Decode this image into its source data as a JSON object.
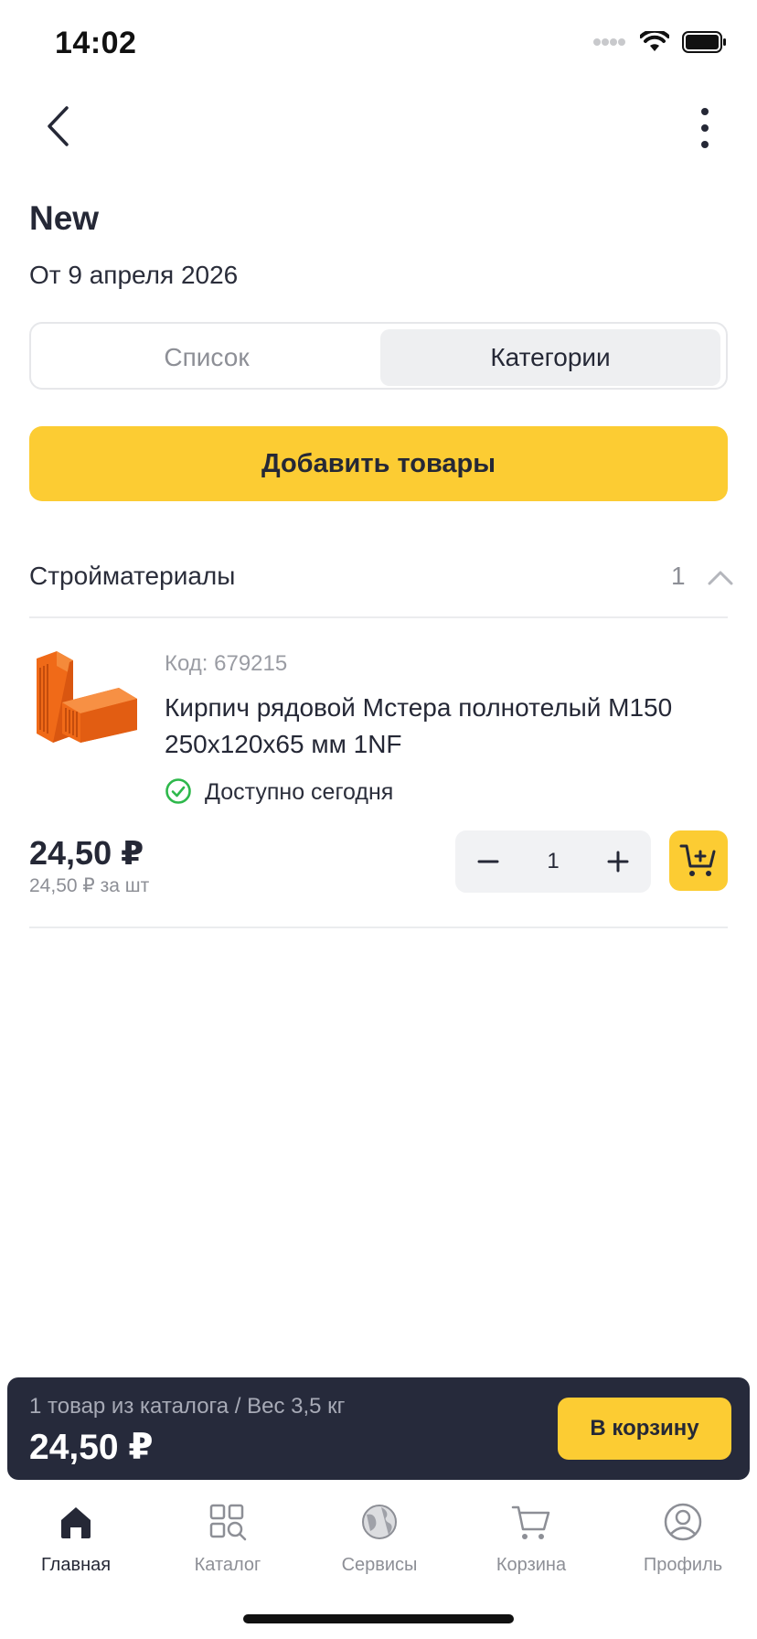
{
  "status_bar": {
    "time": "14:02"
  },
  "header": {
    "title": "New",
    "subtitle": "От 9 апреля 2026"
  },
  "segmented": {
    "options": [
      "Список",
      "Категории"
    ],
    "selected": "Категории"
  },
  "add_button": {
    "label": "Добавить товары"
  },
  "category": {
    "title": "Стройматериалы",
    "count": "1"
  },
  "product": {
    "code": "Код: 679215",
    "name": "Кирпич рядовой Мстера полнотелый М150 250х120х65 мм 1NF",
    "availability": "Доступно сегодня",
    "price": "24,50 ₽",
    "unit_price": "24,50 ₽ за шт",
    "quantity": "1"
  },
  "summary": {
    "info": "1 товар из каталога / Вес 3,5 кг",
    "total": "24,50 ₽",
    "button": "В корзину"
  },
  "tabbar": {
    "items": [
      {
        "label": "Главная",
        "icon": "home-icon",
        "active": true
      },
      {
        "label": "Каталог",
        "icon": "catalog-search-icon",
        "active": false
      },
      {
        "label": "Сервисы",
        "icon": "services-globe-icon",
        "active": false
      },
      {
        "label": "Корзина",
        "icon": "cart-icon",
        "active": false
      },
      {
        "label": "Профиль",
        "icon": "profile-icon",
        "active": false
      }
    ]
  },
  "colors": {
    "accent": "#fccc33",
    "dark_panel": "#262a3b",
    "success": "#2eb84b"
  }
}
